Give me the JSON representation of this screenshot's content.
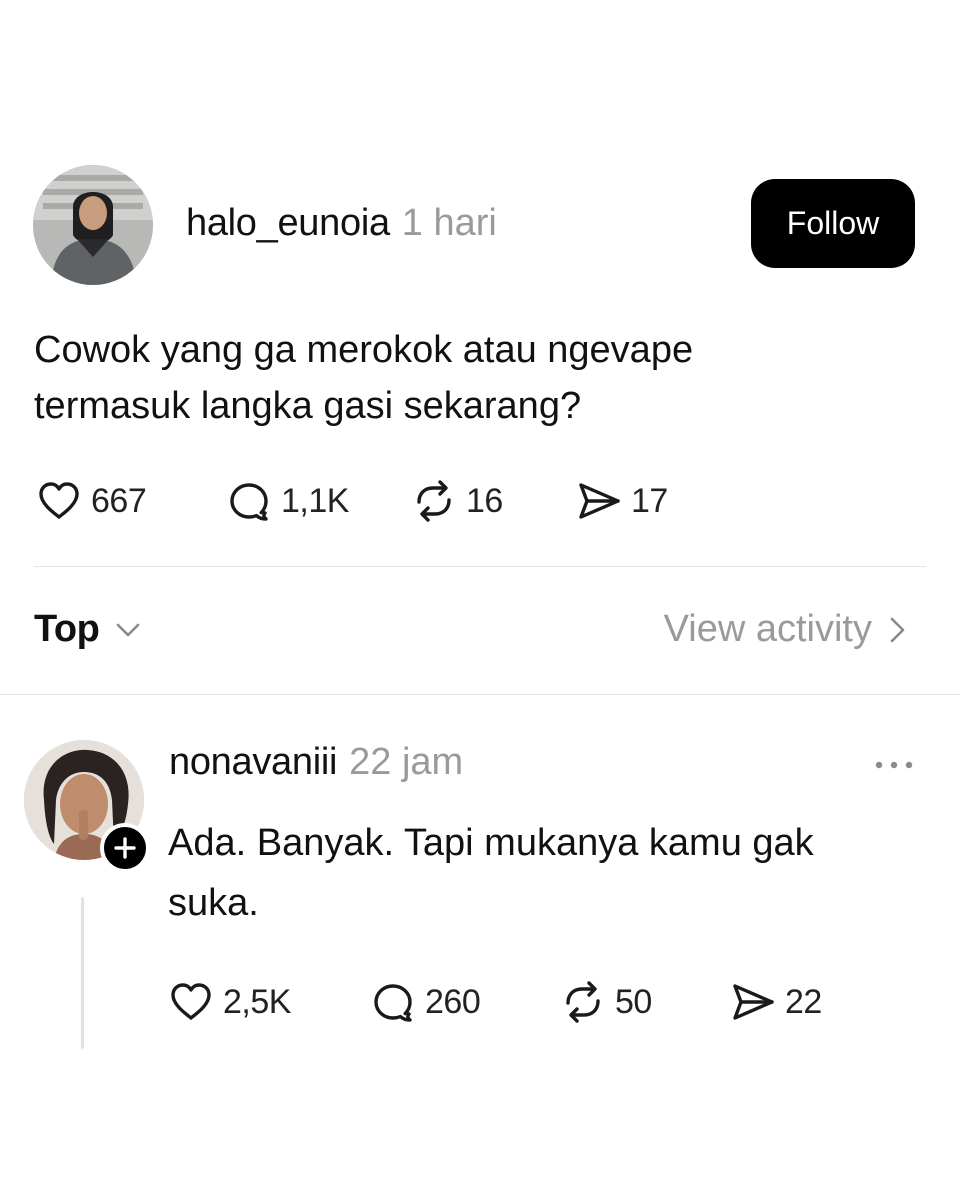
{
  "post": {
    "author": "halo_eunoia",
    "time": "1 hari",
    "follow_label": "Follow",
    "text_lines": [
      "Cowok yang ga merokok atau ngevape",
      "termasuk langka gasi sekarang?"
    ],
    "stats": {
      "likes": "667",
      "comments": "1,1K",
      "reposts": "16",
      "shares": "17"
    }
  },
  "sort_bar": {
    "sort_label": "Top",
    "view_activity_label": "View activity"
  },
  "reply": {
    "author": "nonavaniii",
    "time": "22 jam",
    "text_lines": [
      "Ada. Banyak. Tapi mukanya kamu gak",
      "suka."
    ],
    "stats": {
      "likes": "2,5K",
      "comments": "260",
      "reposts": "50",
      "shares": "22"
    }
  },
  "colors": {
    "text": "#111111",
    "muted": "#9a9a9a",
    "button_bg": "#000000",
    "divider": "#e4e4e4"
  },
  "icons": {
    "like": "heart-icon",
    "comment": "comment-bubble-icon",
    "repost": "repost-icon",
    "share": "send-icon",
    "sort": "chevron-down-icon",
    "view_activity": "chevron-right-icon",
    "more": "more-horizontal-icon",
    "add": "plus-icon"
  }
}
